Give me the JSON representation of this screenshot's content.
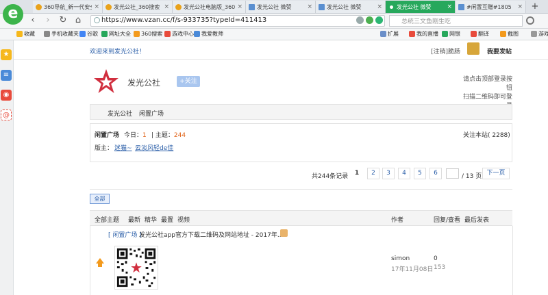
{
  "browser": {
    "tabs": [
      {
        "label": "360导航_新一代安全",
        "icon": "360",
        "active": false
      },
      {
        "label": "发光公社_360搜索",
        "icon": "360",
        "active": false
      },
      {
        "label": "发光公社电脑版_360",
        "icon": "360",
        "active": false
      },
      {
        "label": "发光公社 微赞",
        "icon": "doc",
        "active": false
      },
      {
        "label": "发光公社 微赞",
        "icon": "doc",
        "active": false
      },
      {
        "label": "发光公社 微赞",
        "icon": "green",
        "active": true
      },
      {
        "label": "#闲置互赠#1805",
        "icon": "doc",
        "active": false
      }
    ],
    "new_tab": "+",
    "url": "https://www.vzan.cc/f/s-933735?typeId=411413",
    "search_placeholder": "总统三文鱼刚生吃",
    "nav": {
      "back": "‹",
      "forward": "›",
      "reload": "↻",
      "home": "⌂"
    },
    "bookmarks": [
      "收藏",
      "手机收藏夹",
      "谷歌",
      "网址大全",
      "360搜索",
      "游戏中心",
      "我爱教师"
    ],
    "toolbar_right": [
      "扩展",
      "我的直播",
      "网银",
      "翻译",
      "截图",
      "游戏"
    ]
  },
  "page": {
    "welcome": "欢迎来到发光公社！",
    "logout": "[注销]脆肠",
    "post": "我要发帖",
    "site_name": "发光公社",
    "follow": "+关注",
    "login_hint_1": "请点击顶部登录按钮",
    "login_hint_2": "扫描二维码即可登录",
    "crumb_home": "发光公社",
    "crumb_sub": "闲置广场",
    "forum_name": "闲置广场",
    "today_label": "今日：",
    "today_count": "1",
    "topics_label": "主题：",
    "topics_count": "244",
    "follow_site": "关注本站( 2288)",
    "mods_label": "版主：",
    "mod1": "迷猫~",
    "mod2": "云淡风轻de佳",
    "total_records": "共244条记录",
    "pages": [
      "1",
      "2",
      "3",
      "4",
      "5",
      "6"
    ],
    "page_total": "/ 13 页",
    "next_page": "下一页",
    "all_tab": "全部",
    "filters": [
      "全部主题",
      "最新",
      "精华",
      "最置",
      "视频"
    ],
    "col_author": "作者",
    "col_reply": "回复/查看",
    "col_last": "最后发表",
    "row": {
      "tag": "[ 闲置广场 ]",
      "title": "发光公社app官方下载二维码及网站地址 - 2017年...",
      "author": "simon",
      "date": "17年11月08日",
      "replies": "0",
      "views": "153"
    }
  },
  "colors": {
    "accent": "#2a5ea8",
    "brand_red": "#d12f3f",
    "active_tab": "#27a85c",
    "orange": "#e0651b"
  }
}
